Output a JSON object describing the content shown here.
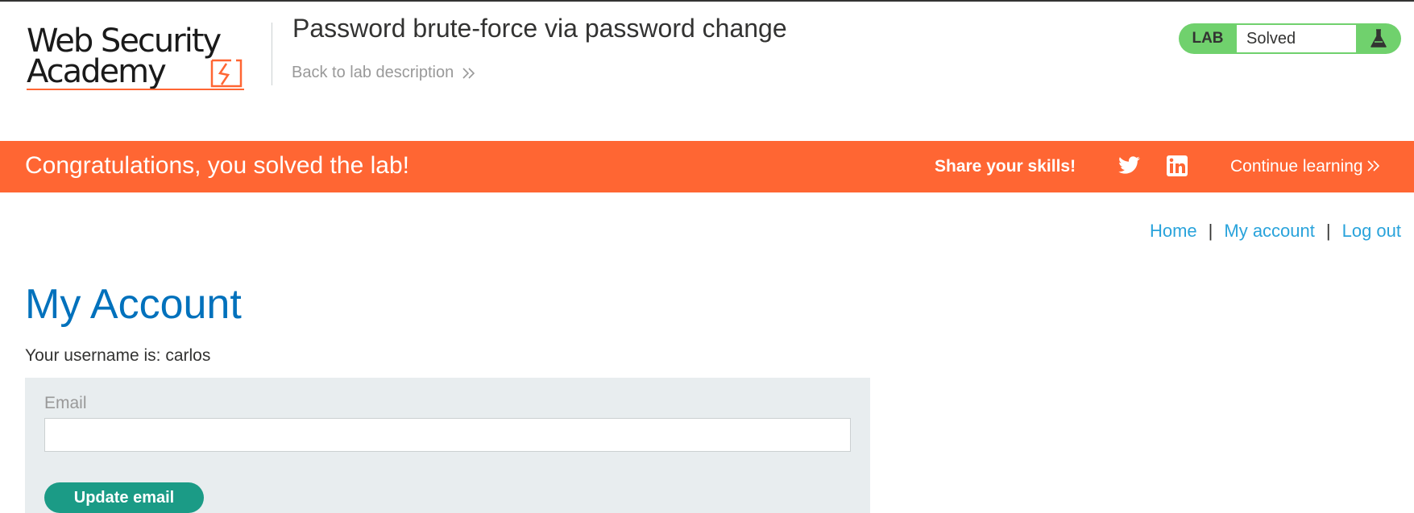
{
  "header": {
    "logo": {
      "line1": "Web Security",
      "line2": "Academy"
    },
    "lab_title": "Password brute-force via password change",
    "back_link": "Back to lab description",
    "status": {
      "label": "LAB",
      "value": "Solved"
    }
  },
  "banner": {
    "message": "Congratulations, you solved the lab!",
    "share": "Share your skills!",
    "continue": "Continue learning"
  },
  "nav": {
    "home": "Home",
    "account": "My account",
    "logout": "Log out",
    "separator": "|"
  },
  "main": {
    "title": "My Account",
    "username_text": "Your username is: carlos",
    "form": {
      "email_label": "Email",
      "email_value": "",
      "submit_label": "Update email"
    }
  },
  "colors": {
    "accent_orange": "#ff6633",
    "solved_green": "#70d16d",
    "link_blue": "#29a3db",
    "title_blue": "#0071bc",
    "button_green": "#1b9b86"
  }
}
